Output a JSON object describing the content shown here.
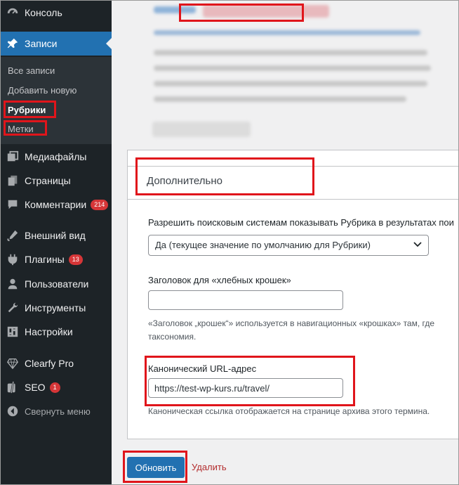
{
  "sidebar": {
    "items": [
      {
        "label": "Консоль",
        "icon": "dashboard-icon"
      },
      {
        "label": "Записи",
        "icon": "pin-icon",
        "active": true
      },
      {
        "label": "Медиафайлы",
        "icon": "media-icon"
      },
      {
        "label": "Страницы",
        "icon": "pages-icon"
      },
      {
        "label": "Комментарии",
        "icon": "comments-icon",
        "badge": "214"
      },
      {
        "label": "Внешний вид",
        "icon": "appearance-icon"
      },
      {
        "label": "Плагины",
        "icon": "plugins-icon",
        "badge": "13"
      },
      {
        "label": "Пользователи",
        "icon": "users-icon"
      },
      {
        "label": "Инструменты",
        "icon": "tools-icon"
      },
      {
        "label": "Настройки",
        "icon": "settings-icon"
      },
      {
        "label": "Clearfy Pro",
        "icon": "diamond-icon"
      },
      {
        "label": "SEO",
        "icon": "yoast-icon",
        "badge": "1"
      }
    ],
    "submenu": [
      "Все записи",
      "Добавить новую",
      "Рубрики",
      "Метки"
    ],
    "collapse_label": "Свернуть меню"
  },
  "panel": {
    "title": "Дополнительно",
    "robots_label": "Разрешить поисковым системам показывать Рубрика в результатах пои",
    "robots_value": "Да (текущее значение по умолчанию для Рубрики)",
    "breadcrumb_label": "Заголовок для «хлебных крошек»",
    "breadcrumb_value": "",
    "breadcrumb_desc_1": "«Заголовок „крошек“» используется в навигационных «крошках» там, где",
    "breadcrumb_desc_2": "таксономия.",
    "canonical_label": "Канонический URL-адрес",
    "canonical_value": "https://test-wp-kurs.ru/travel/",
    "canonical_desc": "Каноническая ссылка отображается на странице архива этого термина."
  },
  "actions": {
    "update_label": "Обновить",
    "delete_label": "Удалить"
  },
  "colors": {
    "sidebar_bg": "#1d2327",
    "accent": "#2271b1",
    "highlight": "#e0151b"
  }
}
